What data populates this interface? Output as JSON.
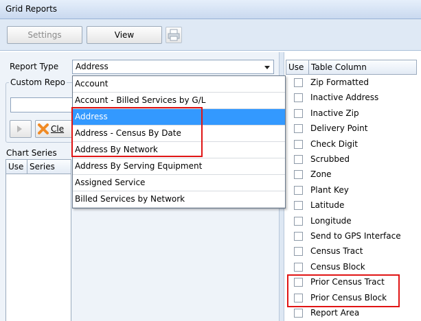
{
  "window": {
    "title": "Grid Reports"
  },
  "toolbar": {
    "settings_label": "Settings",
    "view_label": "View",
    "print_icon": "print-icon"
  },
  "report_type": {
    "label": "Report Type",
    "value": "Address",
    "options": [
      "Account",
      "Account - Billed Services by G/L",
      "Address",
      "Address - Census By Date",
      "Address By Network",
      "Address By Serving Equipment",
      "Assigned Service",
      "Billed Services by Network"
    ],
    "selected_index": 2
  },
  "custom_report": {
    "group_title": "Custom Repo",
    "clear_label": "Cle"
  },
  "chart_series": {
    "title": "Chart Series",
    "columns": [
      "Use",
      "Series"
    ]
  },
  "table_columns": {
    "headers": [
      "Use",
      "Table Column"
    ],
    "rows": [
      "Zip Formatted",
      "Inactive Address",
      "Inactive Zip",
      "Delivery Point",
      "Check Digit",
      "Scrubbed",
      "Zone",
      "Plant Key",
      "Latitude",
      "Longitude",
      "Send to GPS Interface",
      "Census Tract",
      "Census Block",
      "Prior Census Tract",
      "Prior Census Block",
      "Report Area"
    ]
  },
  "colors": {
    "highlight": "#e01414",
    "selection": "#3399ff"
  }
}
